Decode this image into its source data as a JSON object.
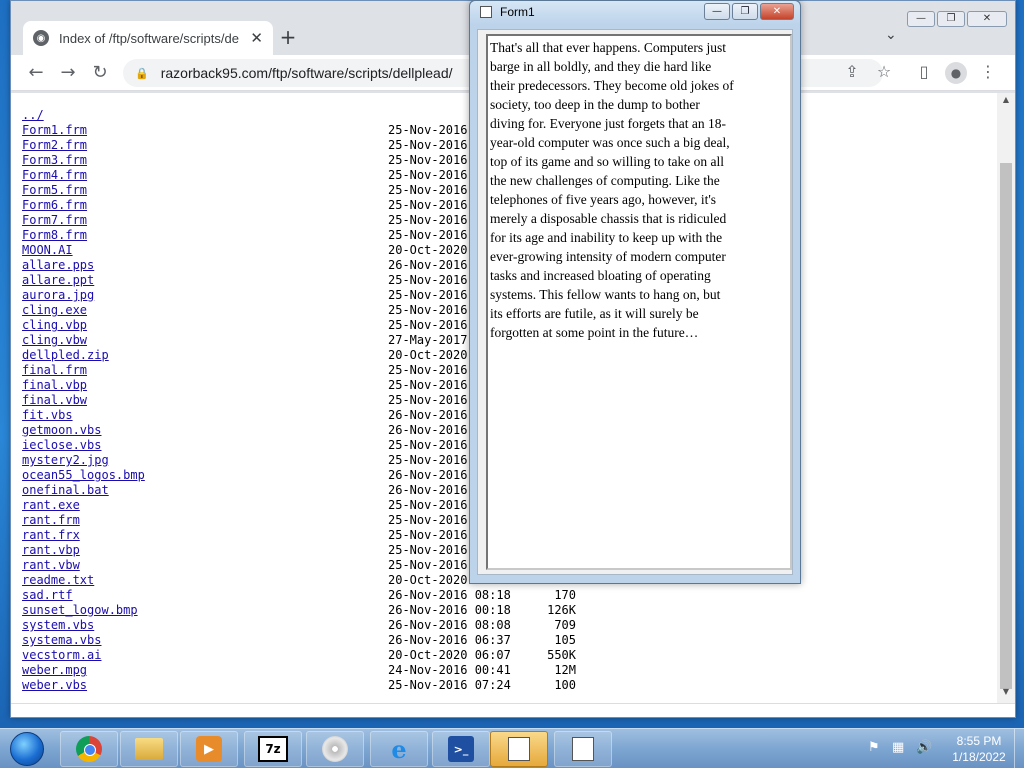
{
  "browser": {
    "tab_title": "Index of /ftp/software/scripts/dellplead/",
    "url": "razorback95.com/ftp/software/scripts/dellplead/",
    "new_tab_label": "+",
    "tab_close": "✕"
  },
  "listing": {
    "parent_link": "../",
    "files": [
      {
        "name": "Form1.frm",
        "date": "25-Nov-2016",
        "size": ""
      },
      {
        "name": "Form2.frm",
        "date": "25-Nov-2016",
        "size": ""
      },
      {
        "name": "Form3.frm",
        "date": "25-Nov-2016",
        "size": ""
      },
      {
        "name": "Form4.frm",
        "date": "25-Nov-2016",
        "size": ""
      },
      {
        "name": "Form5.frm",
        "date": "25-Nov-2016",
        "size": ""
      },
      {
        "name": "Form6.frm",
        "date": "25-Nov-2016",
        "size": ""
      },
      {
        "name": "Form7.frm",
        "date": "25-Nov-2016",
        "size": ""
      },
      {
        "name": "Form8.frm",
        "date": "25-Nov-2016",
        "size": ""
      },
      {
        "name": "MOON.AI",
        "date": "20-Oct-2020",
        "size": ""
      },
      {
        "name": "allare.pps",
        "date": "26-Nov-2016",
        "size": ""
      },
      {
        "name": "allare.ppt",
        "date": "25-Nov-2016",
        "size": ""
      },
      {
        "name": "aurora.jpg",
        "date": "25-Nov-2016",
        "size": ""
      },
      {
        "name": "cling.exe",
        "date": "25-Nov-2016",
        "size": ""
      },
      {
        "name": "cling.vbp",
        "date": "25-Nov-2016",
        "size": ""
      },
      {
        "name": "cling.vbw",
        "date": "27-May-2017",
        "size": ""
      },
      {
        "name": "dellpled.zip",
        "date": "20-Oct-2020",
        "size": ""
      },
      {
        "name": "final.frm",
        "date": "25-Nov-2016",
        "size": ""
      },
      {
        "name": "final.vbp",
        "date": "25-Nov-2016",
        "size": ""
      },
      {
        "name": "final.vbw",
        "date": "25-Nov-2016",
        "size": ""
      },
      {
        "name": "fit.vbs",
        "date": "26-Nov-2016",
        "size": ""
      },
      {
        "name": "getmoon.vbs",
        "date": "26-Nov-2016",
        "size": ""
      },
      {
        "name": "ieclose.vbs",
        "date": "25-Nov-2016",
        "size": ""
      },
      {
        "name": "mystery2.jpg",
        "date": "25-Nov-2016",
        "size": ""
      },
      {
        "name": "ocean55_logos.bmp",
        "date": "26-Nov-2016",
        "size": ""
      },
      {
        "name": "onefinal.bat",
        "date": "26-Nov-2016",
        "size": ""
      },
      {
        "name": "rant.exe",
        "date": "25-Nov-2016",
        "size": ""
      },
      {
        "name": "rant.frm",
        "date": "25-Nov-2016",
        "size": ""
      },
      {
        "name": "rant.frx",
        "date": "25-Nov-2016",
        "size": ""
      },
      {
        "name": "rant.vbp",
        "date": "25-Nov-2016",
        "size": ""
      },
      {
        "name": "rant.vbw",
        "date": "25-Nov-2016",
        "size": ""
      },
      {
        "name": "readme.txt",
        "date": "20-Oct-2020",
        "size": ""
      },
      {
        "name": "sad.rtf",
        "date": "26-Nov-2016 08:18",
        "size": "170"
      },
      {
        "name": "sunset_logow.bmp",
        "date": "26-Nov-2016 00:18",
        "size": "126K"
      },
      {
        "name": "system.vbs",
        "date": "26-Nov-2016 08:08",
        "size": "709"
      },
      {
        "name": "systema.vbs",
        "date": "26-Nov-2016 06:37",
        "size": "105"
      },
      {
        "name": "vecstorm.ai",
        "date": "20-Oct-2020 06:07",
        "size": "550K"
      },
      {
        "name": "weber.mpg",
        "date": "24-Nov-2016 00:41",
        "size": "12M"
      },
      {
        "name": "weber.vbs",
        "date": "25-Nov-2016 07:24",
        "size": "100"
      }
    ]
  },
  "form1": {
    "title": "Form1",
    "text": "That's all that ever happens. Computers just barge in all boldly, and they die hard like their predecessors. They become old jokes of society, too deep in the dump to bother diving for. Everyone just forgets that an 18-year-old computer was once such a big deal, top of its game and so willing to take on all the new challenges of computing. Like the telephones of five years ago, however, it's merely a disposable chassis that is ridiculed for its age and inability to keep up with the ever-growing intensity of modern computer tasks and increased bloating of operating systems. This fellow wants to hang on, but its efforts are futile, as it will surely be forgotten at some point in the future…"
  },
  "taskbar": {
    "apps": [
      {
        "id": "chrome",
        "icon": "chrome-icon"
      },
      {
        "id": "explorer",
        "icon": "folder-icon"
      },
      {
        "id": "media-player",
        "icon": "media-player-icon"
      },
      {
        "id": "7zip",
        "icon": "7zip-icon",
        "label": "7z"
      },
      {
        "id": "cd-player",
        "icon": "cd-icon"
      },
      {
        "id": "internet-explorer",
        "icon": "ie-icon",
        "label": "e"
      },
      {
        "id": "powershell",
        "icon": "powershell-icon",
        "label": ">_"
      },
      {
        "id": "form1-app",
        "icon": "window-icon",
        "active": true
      },
      {
        "id": "window-2",
        "icon": "window-icon"
      }
    ],
    "time": "8:55 PM",
    "date": "1/18/2022"
  }
}
